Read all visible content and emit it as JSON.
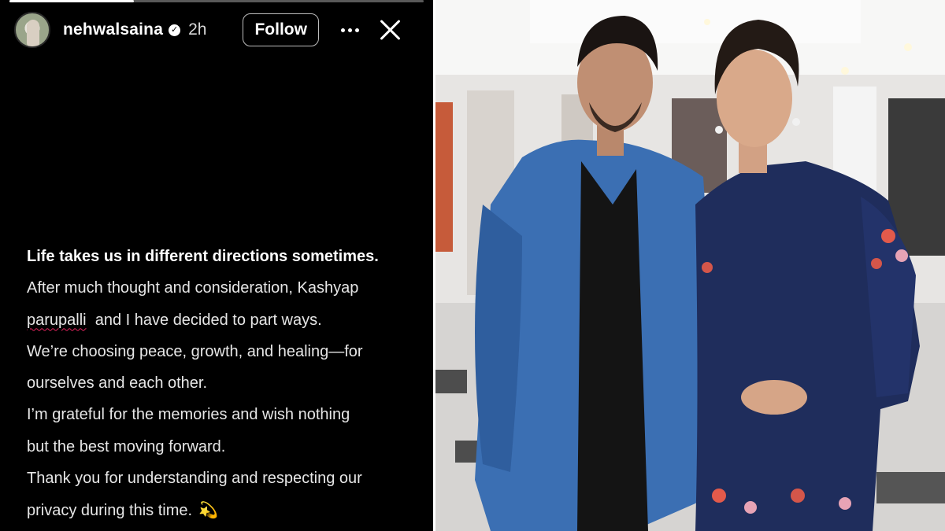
{
  "story": {
    "progress": 0.3,
    "header": {
      "username": "nehwalsaina",
      "time": "2h",
      "follow_label": "Follow",
      "icons": [
        "avatar",
        "verified-badge-icon",
        "more-icon",
        "close-icon"
      ]
    },
    "message": {
      "line1": "Life takes us in different directions sometimes.",
      "line2": "After much thought and consideration, Kashyap",
      "line3_a": "parupalli",
      "line3_b": "  and I have decided to part ways.",
      "line4": "We’re choosing peace, growth, and healing—for",
      "line5": "ourselves and each other.",
      "line6": "I’m grateful for the memories and wish nothing",
      "line7": "but the best moving forward.",
      "line8": "Thank you for understanding and respecting our",
      "line9": "privacy during this time.",
      "emoji": "💫"
    }
  },
  "photo": {
    "colors": {
      "jacket": "#3b6fb3",
      "kurta": "#1f2d5c",
      "background": "#efeeed"
    }
  }
}
